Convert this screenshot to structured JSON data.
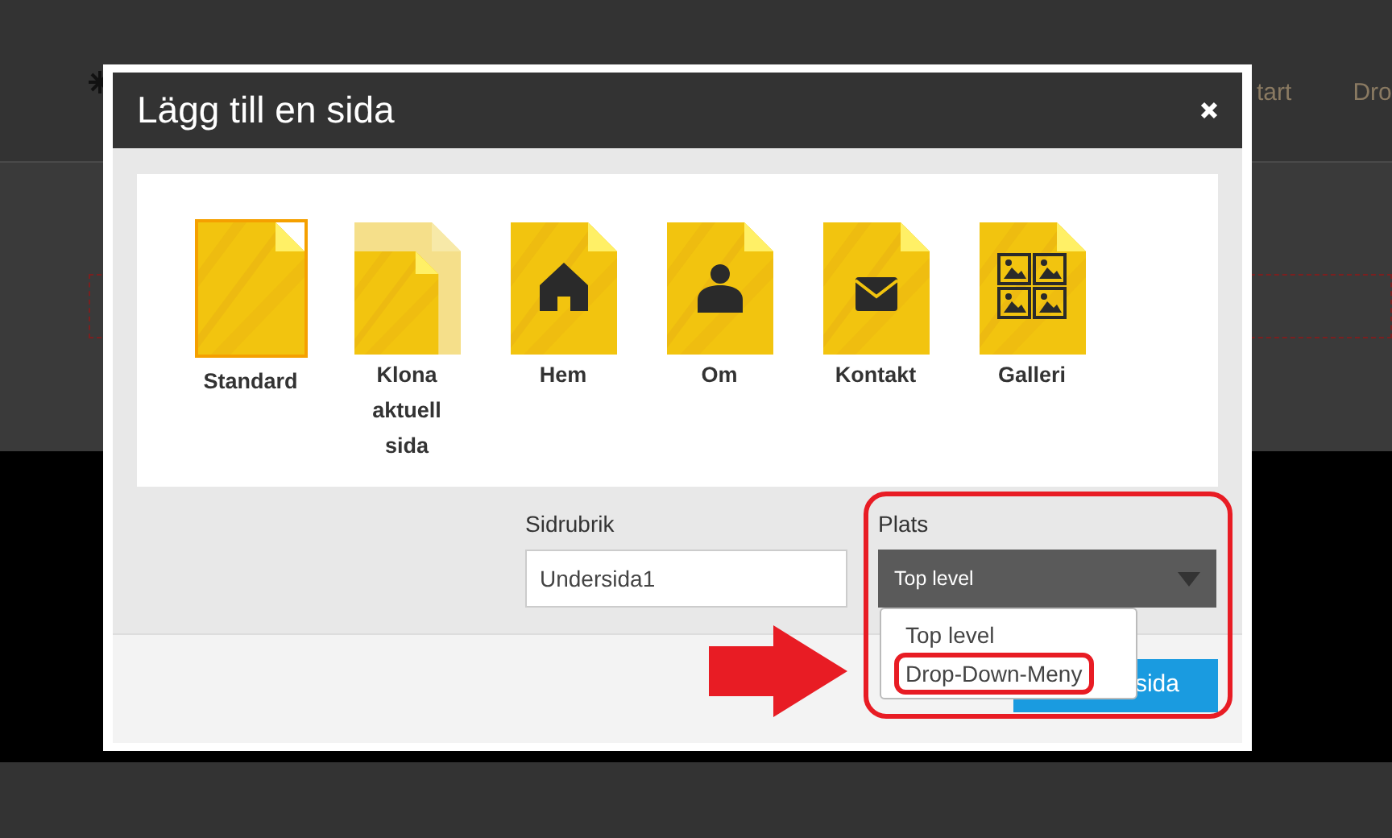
{
  "background": {
    "nav_items": [
      "tart",
      "Dro"
    ]
  },
  "dialog": {
    "title": "Lägg till en sida",
    "templates": [
      {
        "label": "Standard",
        "kind": "blank",
        "selected": true
      },
      {
        "label": "Klona aktuell sida",
        "kind": "clone",
        "selected": false
      },
      {
        "label": "Hem",
        "kind": "home",
        "selected": false
      },
      {
        "label": "Om",
        "kind": "person",
        "selected": false
      },
      {
        "label": "Kontakt",
        "kind": "mail",
        "selected": false
      },
      {
        "label": "Galleri",
        "kind": "gallery",
        "selected": false
      }
    ],
    "title_field": {
      "label": "Sidrubrik",
      "value": "Undersida1"
    },
    "location_field": {
      "label": "Plats",
      "value": "Top level"
    },
    "location_options": [
      {
        "label": "Top level",
        "annotated": false
      },
      {
        "label": "Drop-Down-Meny",
        "annotated": true
      }
    ],
    "primary_button": "sida"
  }
}
